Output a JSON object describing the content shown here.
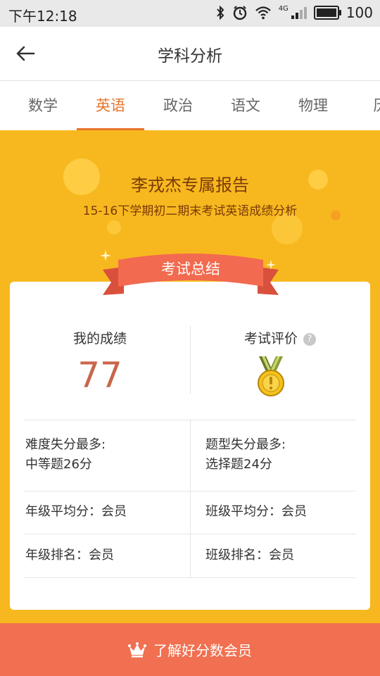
{
  "status_bar": {
    "time": "下午12:18",
    "network": "4G",
    "battery": "100",
    "battery_level": 1.0
  },
  "header": {
    "title": "学科分析"
  },
  "tabs": [
    {
      "label": "数学",
      "active": false
    },
    {
      "label": "英语",
      "active": true
    },
    {
      "label": "政治",
      "active": false
    },
    {
      "label": "语文",
      "active": false
    },
    {
      "label": "物理",
      "active": false
    },
    {
      "label": "历",
      "active": false
    }
  ],
  "banner": {
    "title": "李戎杰专属报告",
    "subtitle": "15-16下学期初二期末考试英语成绩分析"
  },
  "ribbon": {
    "label": "考试总结"
  },
  "summary": {
    "my_score_label": "我的成绩",
    "my_score_value": "77",
    "evaluation_label": "考试评价",
    "help_mark": "?"
  },
  "details": {
    "difficulty_label": "难度失分最多:",
    "difficulty_value": "中等题26分",
    "question_type_label": "题型失分最多:",
    "question_type_value": "选择题24分",
    "grade_avg": "年级平均分：会员",
    "class_avg": "班级平均分：会员",
    "grade_rank": "年级排名：会员",
    "class_rank": "班级排名：会员"
  },
  "footer": {
    "label": "了解好分数会员"
  },
  "colors": {
    "accent": "#e8742c",
    "background": "#f7b81f",
    "footer": "#f07051",
    "score": "#c9664a"
  }
}
